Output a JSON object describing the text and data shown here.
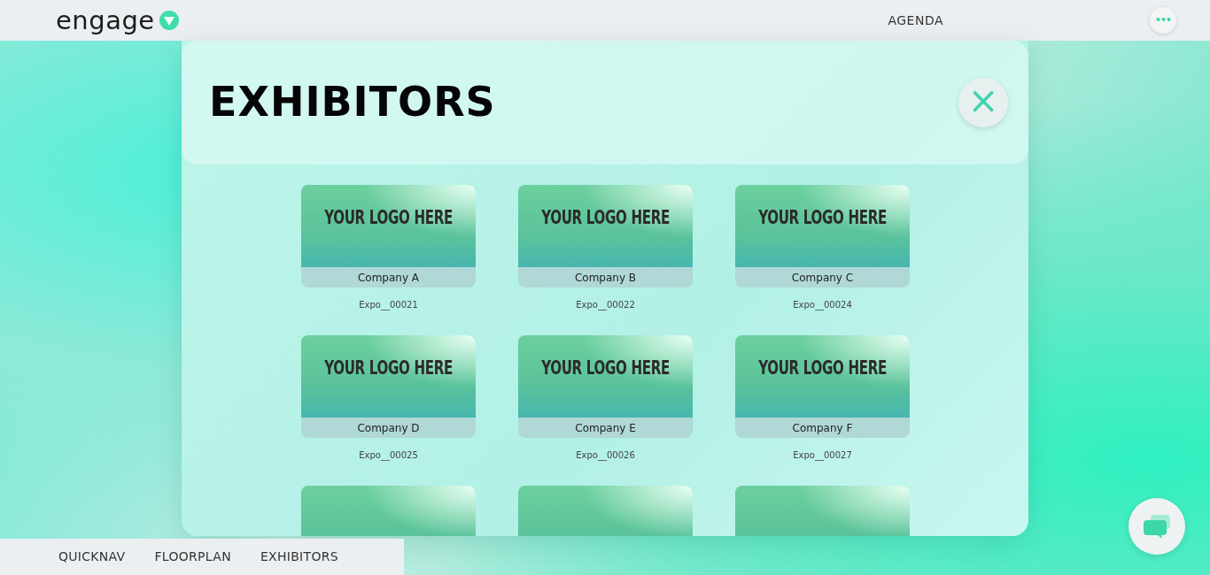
{
  "header": {
    "brand": "engage",
    "nav": [
      {
        "label": "AGENDA"
      }
    ],
    "menu_button": "•••"
  },
  "modal": {
    "title": "EXHIBITORS",
    "close": "×",
    "exhibitors": [
      {
        "kind": "card",
        "logo_text": "YOUR LOGO HERE",
        "name": "Company A",
        "code": "Expo__00021"
      },
      {
        "kind": "card",
        "logo_text": "YOUR LOGO HERE",
        "name": "Company B",
        "code": "Expo__00022"
      },
      {
        "kind": "card",
        "logo_text": "YOUR LOGO HERE",
        "name": "Company C",
        "code": "Expo__00024"
      },
      {
        "kind": "card",
        "logo_text": "YOUR LOGO HERE",
        "name": "Company D",
        "code": "Expo__00025"
      },
      {
        "kind": "card",
        "logo_text": "YOUR LOGO HERE",
        "name": "Company E",
        "code": "Expo__00026"
      },
      {
        "kind": "card",
        "logo_text": "YOUR LOGO HERE",
        "name": "Company F",
        "code": "Expo__00027"
      },
      {
        "kind": "cut_off"
      },
      {
        "kind": "cut_off"
      },
      {
        "kind": "cut_off"
      }
    ]
  },
  "bottom_nav": [
    {
      "label": "QUICKNAV"
    },
    {
      "label": "FLOORPLAN"
    },
    {
      "label": "EXHIBITORS"
    }
  ]
}
